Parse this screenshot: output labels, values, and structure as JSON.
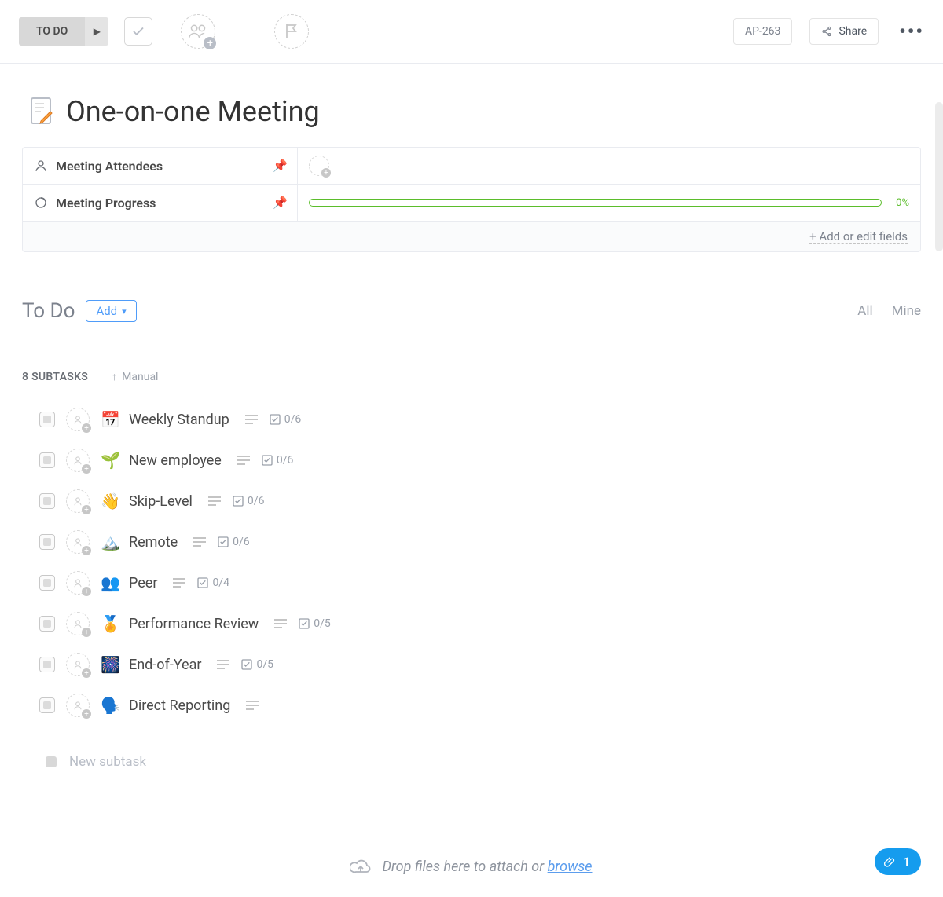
{
  "toolbar": {
    "status_label": "TO DO",
    "task_id": "AP-263",
    "share_label": "Share"
  },
  "title": "One-on-one Meeting",
  "fields": {
    "attendees_label": "Meeting Attendees",
    "progress_label": "Meeting Progress",
    "progress_pct": "0%",
    "add_edit_label": "+ Add or edit fields"
  },
  "todo": {
    "heading": "To Do",
    "add_label": "Add",
    "filter_all": "All",
    "filter_mine": "Mine",
    "subtasks_count_label": "8 SUBTASKS",
    "sort_label": "Manual",
    "new_subtask_placeholder": "New subtask"
  },
  "subtasks": [
    {
      "emoji": "📅",
      "name": "Weekly Standup",
      "done": "0/6"
    },
    {
      "emoji": "🌱",
      "name": "New employee",
      "done": "0/6"
    },
    {
      "emoji": "👋",
      "name": "Skip-Level",
      "done": "0/6"
    },
    {
      "emoji": "🏔️",
      "name": "Remote",
      "done": "0/6"
    },
    {
      "emoji": "👥",
      "name": "Peer",
      "done": "0/4"
    },
    {
      "emoji": "🏅",
      "name": "Performance Review",
      "done": "0/5"
    },
    {
      "emoji": "🎆",
      "name": "End-of-Year",
      "done": "0/5"
    },
    {
      "emoji": "🗣️",
      "name": "Direct Reporting",
      "done": ""
    }
  ],
  "dropbar": {
    "text": "Drop files here to attach or ",
    "link": "browse"
  },
  "float_badge": "1"
}
